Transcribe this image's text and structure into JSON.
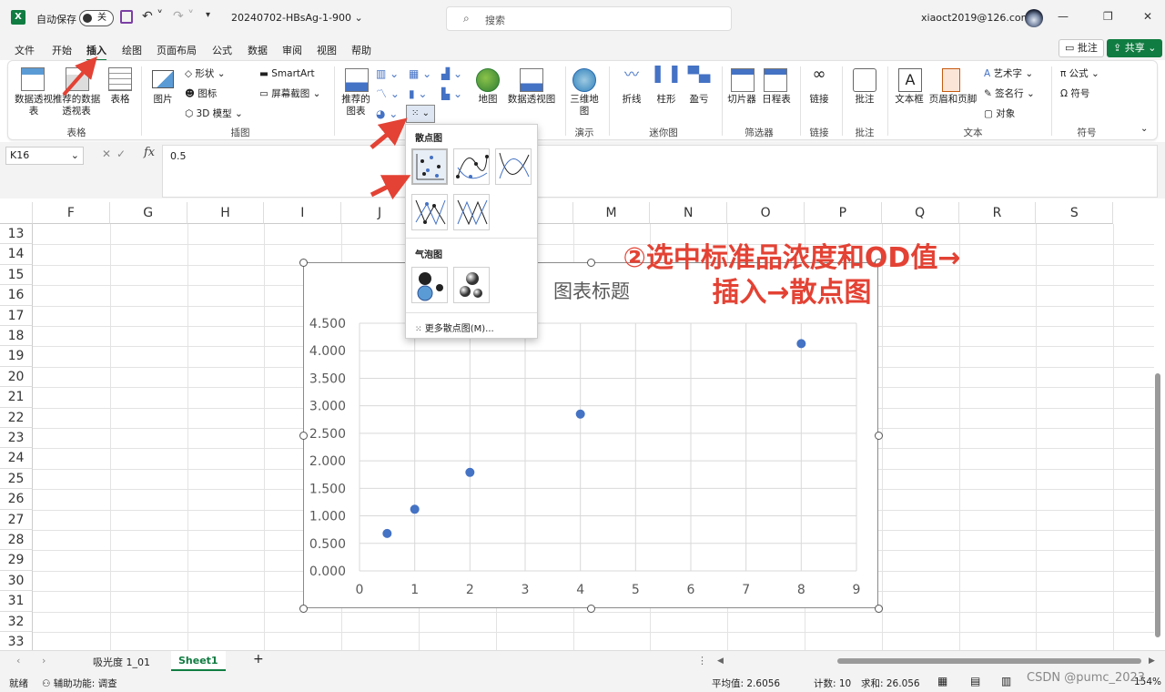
{
  "titlebar": {
    "autosave_label": "自动保存",
    "autosave_state": "关",
    "filename": "20240702-HBsAg-1-900",
    "search_placeholder": "搜索",
    "user": "xiaoct2019@126.com"
  },
  "tabs": [
    "文件",
    "开始",
    "插入",
    "绘图",
    "页面布局",
    "公式",
    "数据",
    "审阅",
    "视图",
    "帮助"
  ],
  "active_tab": "插入",
  "comments_button": "批注",
  "share_button": "共享",
  "ribbon": {
    "pivot_table": "数据透视表",
    "recommended_pivot": "推荐的数据透视表",
    "table": "表格",
    "group_tables": "表格",
    "pictures": "图片",
    "shapes": "形状",
    "icons": "图标",
    "models_3d": "3D 模型",
    "smartart": "SmartArt",
    "screenshot": "屏幕截图",
    "group_illustrations": "插图",
    "recommended_charts": "推荐的图表",
    "maps": "地图",
    "pivot_chart": "数据透视图",
    "map_3d": "三维地图",
    "group_tours": "演示",
    "spark_line": "折线",
    "spark_column": "柱形",
    "spark_winloss": "盈亏",
    "group_sparklines": "迷你图",
    "slicer": "切片器",
    "timeline": "日程表",
    "group_filters": "筛选器",
    "link": "链接",
    "group_links": "链接",
    "comment": "批注",
    "group_comments": "批注",
    "textbox": "文本框",
    "header_footer": "页眉和页脚",
    "wordart": "艺术字",
    "signature": "签名行",
    "object": "对象",
    "group_text": "文本",
    "equation": "公式",
    "symbol": "符号",
    "group_symbols": "符号"
  },
  "formula": {
    "namebox": "K16",
    "fx": "fx",
    "content": "0.5"
  },
  "columns": [
    "F",
    "G",
    "H",
    "I",
    "J",
    "K",
    "L",
    "M",
    "N",
    "O",
    "P",
    "Q",
    "R",
    "S"
  ],
  "rows": [
    "13",
    "14",
    "15",
    "16",
    "17",
    "18",
    "19",
    "20",
    "21",
    "22",
    "23",
    "24",
    "25",
    "26",
    "27",
    "28",
    "29",
    "30",
    "31",
    "32",
    "33"
  ],
  "dropdown": {
    "scatter_title": "散点图",
    "bubble_title": "气泡图",
    "more": "更多散点图(M)..."
  },
  "annotation": {
    "line1": "②选中标准品浓度和OD值→",
    "line2": "插入→散点图"
  },
  "chart_data": {
    "type": "scatter",
    "title": "图表标题",
    "x": [
      0.5,
      1,
      2,
      4,
      8
    ],
    "y": [
      0.68,
      1.12,
      1.79,
      2.85,
      4.13
    ],
    "xlim": [
      0,
      9
    ],
    "ylim": [
      0,
      4.5
    ],
    "x_ticks": [
      "0",
      "1",
      "2",
      "3",
      "4",
      "5",
      "6",
      "7",
      "8",
      "9"
    ],
    "y_ticks": [
      "0.000",
      "0.500",
      "1.000",
      "1.500",
      "2.000",
      "2.500",
      "3.000",
      "3.500",
      "4.000",
      "4.500"
    ],
    "grid": true,
    "point_color": "#4472c4"
  },
  "sheets": [
    "吸光度 1_01",
    "Sheet1"
  ],
  "active_sheet": "Sheet1",
  "status": {
    "ready": "就绪",
    "accessibility": "辅助功能: 调查",
    "average": "平均值: 2.6056",
    "count": "计数: 10",
    "sum": "求和: 26.056",
    "zoom": "154%",
    "watermark": "CSDN @pumc_2023"
  }
}
